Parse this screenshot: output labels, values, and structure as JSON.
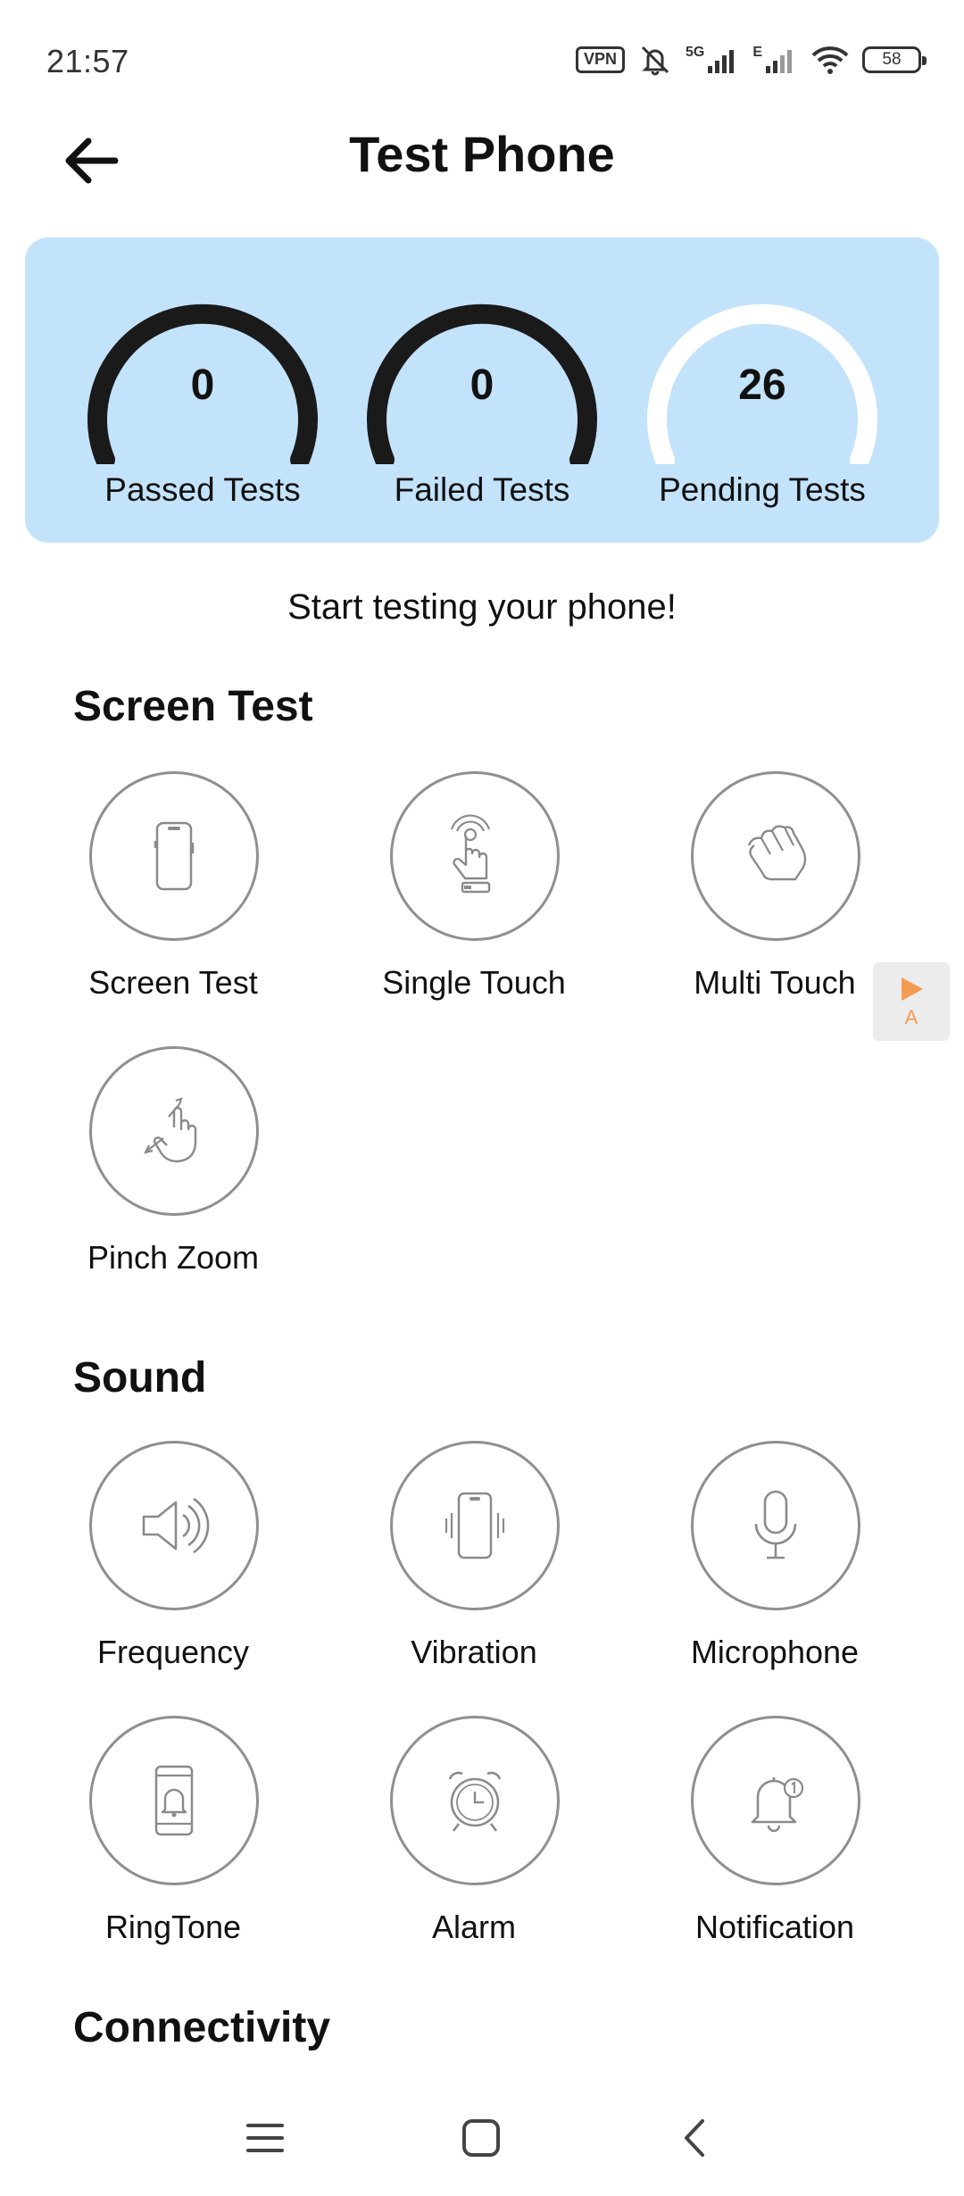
{
  "status_bar": {
    "time": "21:57",
    "vpn": "VPN",
    "network_5g": "5G",
    "network_e": "E",
    "battery": "58"
  },
  "header": {
    "title": "Test Phone",
    "back_icon": "arrow-left-icon"
  },
  "summary": {
    "passed": {
      "value": "0",
      "label": "Passed Tests"
    },
    "failed": {
      "value": "0",
      "label": "Failed Tests"
    },
    "pending": {
      "value": "26",
      "label": "Pending Tests"
    },
    "card_color": "#c3e3fb"
  },
  "intro": "Start testing your phone!",
  "sections": {
    "screen": {
      "title": "Screen Test",
      "items": [
        {
          "label": "Screen Test",
          "icon": "smartphone-icon"
        },
        {
          "label": "Single Touch",
          "icon": "single-touch-icon"
        },
        {
          "label": "Multi Touch",
          "icon": "multi-touch-icon"
        },
        {
          "label": "Pinch Zoom",
          "icon": "pinch-zoom-icon"
        }
      ]
    },
    "sound": {
      "title": "Sound",
      "items": [
        {
          "label": "Frequency",
          "icon": "speaker-icon"
        },
        {
          "label": "Vibration",
          "icon": "vibration-icon"
        },
        {
          "label": "Microphone",
          "icon": "microphone-icon"
        },
        {
          "label": "RingTone",
          "icon": "ringtone-icon"
        },
        {
          "label": "Alarm",
          "icon": "alarm-clock-icon"
        },
        {
          "label": "Notification",
          "icon": "notification-bell-icon"
        }
      ]
    },
    "connectivity": {
      "title": "Connectivity"
    }
  },
  "floating_badge": {
    "letter": "A",
    "accent": "#f59a52"
  }
}
